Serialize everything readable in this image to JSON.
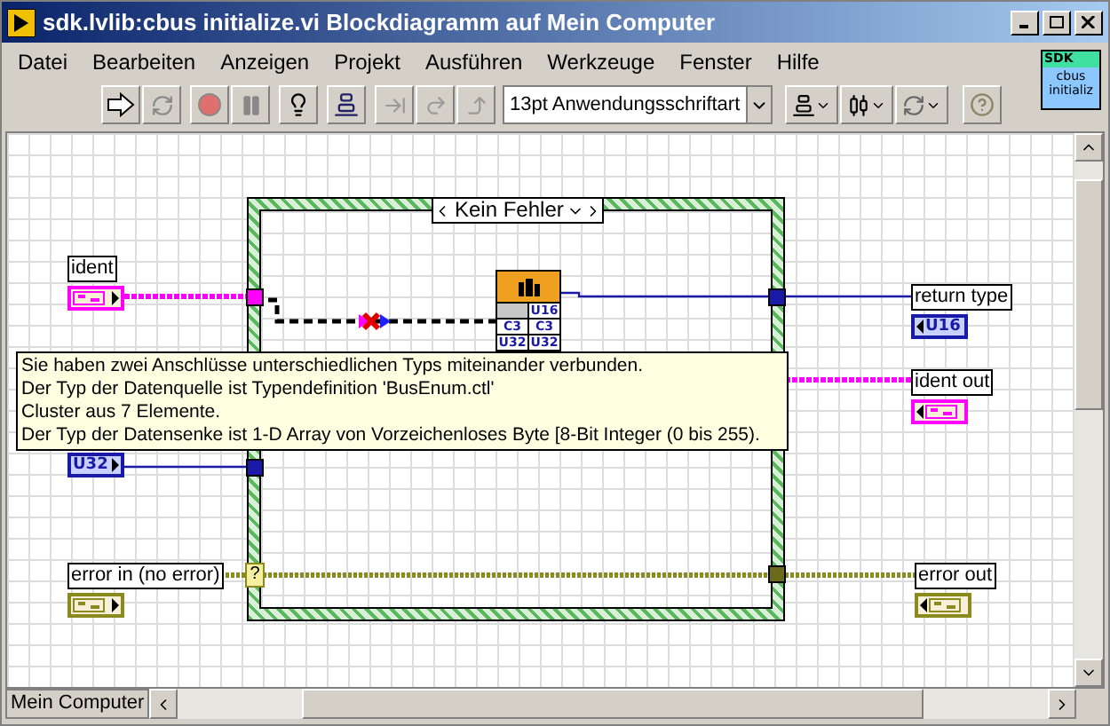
{
  "window": {
    "title": "sdk.lvlib:cbus initialize.vi Blockdiagramm auf Mein Computer"
  },
  "menu": [
    "Datei",
    "Bearbeiten",
    "Anzeigen",
    "Projekt",
    "Ausführen",
    "Werkzeuge",
    "Fenster",
    "Hilfe"
  ],
  "toolbar": {
    "font_dropdown": "13pt Anwendungsschriftart"
  },
  "vi_icon": {
    "line_1": "SDK",
    "line_2": "cbus",
    "line_3": "initializ"
  },
  "diagram": {
    "case_selector": "Kein Fehler",
    "terminals": [
      {
        "label": "ident",
        "kind": "cluster",
        "indicator": false,
        "color": "#ff00ff"
      },
      {
        "label": "return type",
        "kind": "numeric",
        "indicator": true,
        "text": "U16",
        "color": "#1a1aa8"
      },
      {
        "label": "ident out",
        "kind": "cluster",
        "indicator": true,
        "color": "#ff00ff"
      },
      {
        "kind": "numeric",
        "indicator": false,
        "text": "U32",
        "color": "#1a1aa8"
      },
      {
        "label": "error in (no error)",
        "kind": "cluster",
        "indicator": false,
        "color": "#8a8a1e"
      },
      {
        "label": "error out",
        "kind": "cluster",
        "indicator": true,
        "color": "#8a8a1e"
      }
    ],
    "node_rows": [
      [
        "",
        "U16"
      ],
      [
        "C3",
        "C3"
      ],
      [
        "U32",
        "U32"
      ]
    ],
    "case_tunnel": "?"
  },
  "tooltip": {
    "lines": [
      "Sie haben zwei Anschlüsse unterschiedlichen Typs miteinander verbunden.",
      "Der Typ der Datenquelle ist Typendefinition 'BusEnum.ctl'",
      "Cluster aus 7 Elemente.",
      "Der Typ der Datensenke ist 1-D Array von Vorzeichenloses Byte [8-Bit Integer (0 bis 255)."
    ]
  },
  "status_bar": {
    "context": "Mein Computer"
  }
}
